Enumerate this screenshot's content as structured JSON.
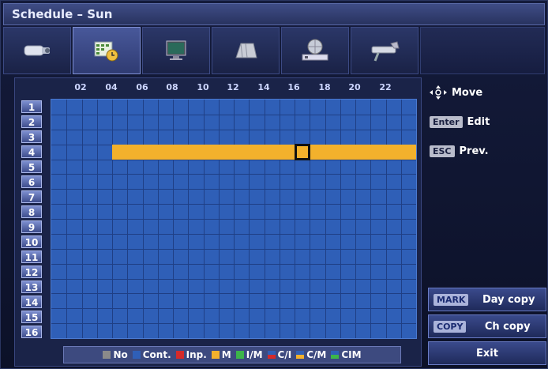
{
  "title": "Schedule – Sun",
  "tabs": [
    {
      "icon": "camera-icon"
    },
    {
      "icon": "schedule-clock-icon",
      "active": true
    },
    {
      "icon": "monitor-icon"
    },
    {
      "icon": "storage-icon"
    },
    {
      "icon": "network-icon"
    },
    {
      "icon": "tools-icon"
    }
  ],
  "hours": [
    "02",
    "04",
    "06",
    "08",
    "10",
    "12",
    "14",
    "16",
    "18",
    "20",
    "22"
  ],
  "channels": [
    "1",
    "2",
    "3",
    "4",
    "5",
    "6",
    "7",
    "8",
    "9",
    "10",
    "11",
    "12",
    "13",
    "14",
    "15",
    "16"
  ],
  "selected_channel": "4",
  "help": {
    "move": "Move",
    "enter_key": "Enter",
    "edit": "Edit",
    "esc_key": "ESC",
    "prev": "Prev."
  },
  "buttons": {
    "mark_key": "MARK",
    "day_copy": "Day copy",
    "copy_key": "COPY",
    "ch_copy": "Ch copy",
    "exit": "Exit"
  },
  "legend": {
    "no": "No",
    "cont": "Cont.",
    "inp": "Inp.",
    "m": "M",
    "im": "I/M",
    "ci": "C/I",
    "cm": "C/M",
    "cim": "CIM"
  },
  "colors": {
    "no": "#8a8a8a",
    "cont": "#2f5fb7",
    "inp": "#d42a2a",
    "m": "#f3b12c",
    "im": "#3cb54a",
    "accent": "#3f4d86"
  }
}
